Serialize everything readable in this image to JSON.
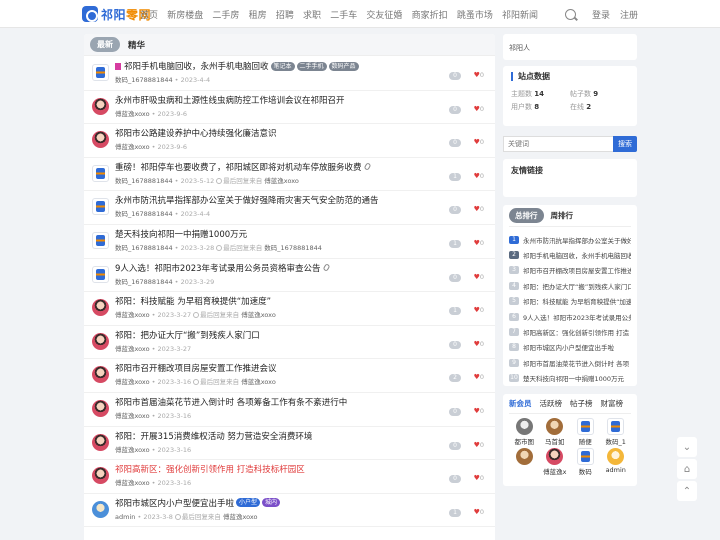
{
  "brand": {
    "part1": "祁阳",
    "part2": "零网"
  },
  "nav": [
    "首页",
    "新房楼盘",
    "二手房",
    "租房",
    "招聘",
    "求职",
    "二手车",
    "交友征婚",
    "商家折扣",
    "跳蚤市场",
    "祁阳新闻"
  ],
  "auth": {
    "login": "登录",
    "register": "注册"
  },
  "tabs": {
    "latest": "最新",
    "best": "精华"
  },
  "threads": [
    {
      "title": "祁阳手机电脑回收，永州手机电脑回收",
      "flag": true,
      "tags": [
        "笔记本",
        "二手手机",
        "数码产品"
      ],
      "author": "数码_1678881844",
      "date": "2023-4-4",
      "last_reply": "",
      "last_user": "",
      "replies": "0",
      "likes": "0",
      "avatar": "icon"
    },
    {
      "title": "永州市肝吸虫病和土源性线虫病防控工作培训会议在祁阳召开",
      "author": "傅蓝逸xoxo",
      "date": "2023-9-6",
      "last_reply": "",
      "last_user": "",
      "replies": "0",
      "likes": "0",
      "avatar": "pink"
    },
    {
      "title": "祁阳市公路建设养护中心持续强化廉洁意识",
      "author": "傅蓝逸xoxo",
      "date": "2023-9-6",
      "last_reply": "",
      "last_user": "",
      "replies": "0",
      "likes": "0",
      "avatar": "pink"
    },
    {
      "title": "重磅！祁阳停车也要收费了，祁阳城区即将对机动车停放服务收费",
      "attach": true,
      "author": "数码_1678881844",
      "date": "2023-5-12",
      "last_reply": "最后回复来自",
      "last_user": "傅蓝逸xoxo",
      "replies": "1",
      "likes": "0",
      "avatar": "icon"
    },
    {
      "title": "永州市防汛抗旱指挥部办公室关于做好强降雨灾害天气安全防范的通告",
      "author": "数码_1678881844",
      "date": "2023-4-4",
      "last_reply": "",
      "last_user": "",
      "replies": "0",
      "likes": "0",
      "avatar": "icon"
    },
    {
      "title": "楚天科技向祁阳一中捐赠1000万元",
      "author": "数码_1678881844",
      "date": "2023-3-28",
      "last_reply": "最后回复来自",
      "last_user": "数码_1678881844",
      "replies": "1",
      "likes": "0",
      "avatar": "icon"
    },
    {
      "title": "9人入选！祁阳市2023年考试录用公务员资格审查公告",
      "attach": true,
      "author": "数码_1678881844",
      "date": "2023-3-29",
      "last_reply": "",
      "last_user": "",
      "replies": "0",
      "likes": "0",
      "avatar": "icon"
    },
    {
      "title": "祁阳：科技赋能 为早稻育秧提供“加速度”",
      "author": "傅蓝逸xoxo",
      "date": "2023-3-27",
      "last_reply": "最后回复来自",
      "last_user": "傅蓝逸xoxo",
      "replies": "1",
      "likes": "0",
      "avatar": "pink"
    },
    {
      "title": "祁阳：把办证大厅“搬”到残疾人家门口",
      "author": "傅蓝逸xoxo",
      "date": "2023-3-27",
      "last_reply": "",
      "last_user": "",
      "replies": "0",
      "likes": "0",
      "avatar": "pink"
    },
    {
      "title": "祁阳市召开棚改项目房屋安置工作推进会议",
      "author": "傅蓝逸xoxo",
      "date": "2023-3-16",
      "last_reply": "最后回复来自",
      "last_user": "傅蓝逸xoxo",
      "replies": "2",
      "likes": "0",
      "avatar": "pink"
    },
    {
      "title": "祁阳市首届油菜花节进入倒计时 各项筹备工作有条不紊进行中",
      "author": "傅蓝逸xoxo",
      "date": "2023-3-16",
      "last_reply": "",
      "last_user": "",
      "replies": "0",
      "likes": "0",
      "avatar": "pink"
    },
    {
      "title": "祁阳：开展315消费维权活动 努力营造安全消费环境",
      "author": "傅蓝逸xoxo",
      "date": "2023-3-16",
      "last_reply": "",
      "last_user": "",
      "replies": "0",
      "likes": "0",
      "avatar": "pink"
    },
    {
      "title": "祁阳高新区：强化创新引领作用 打造科技标杆园区",
      "red": true,
      "author": "傅蓝逸xoxo",
      "date": "2023-3-16",
      "last_reply": "",
      "last_user": "",
      "replies": "0",
      "likes": "0",
      "avatar": "pink"
    },
    {
      "title": "祁阳市城区内小户型便宜出手啦",
      "tags2": [
        "小户型",
        "城内"
      ],
      "author": "admin",
      "date": "2023-3-8",
      "last_reply": "最后回复来自",
      "last_user": "傅蓝逸xoxo",
      "replies": "1",
      "likes": "0",
      "avatar": "blue"
    }
  ],
  "sidebar": {
    "location": "祁阳人",
    "stats_title": "站点数据",
    "stats": [
      {
        "label": "主题数",
        "value": "14"
      },
      {
        "label": "帖子数",
        "value": "9"
      },
      {
        "label": "用户数",
        "value": "8"
      },
      {
        "label": "在线",
        "value": "2"
      }
    ],
    "search_placeholder": "关键词",
    "search_button": "搜索",
    "links_title": "友情链接",
    "rank_tabs": {
      "a": "总排行",
      "b": "周排行"
    },
    "rank": [
      "永州市防汛抗旱指挥部办公室关于做好",
      "祁阳手机电脑回收，永州手机电脑回收",
      "祁阳市召开棚改项目房屋安置工作推进",
      "祁阳：把办证大厅“搬”到残疾人家门口",
      "祁阳：科技赋能 为早稻育秧提供“加速",
      "9人入选！祁阳市2023年考试录用公务",
      "祁阳高新区：强化创新引领作用 打造",
      "祁阳市城区内小户型便宜出手啦",
      "祁阳市首届油菜花节进入倒计时 各项",
      "楚天科技向祁阳一中捐赠1000万元"
    ],
    "member_tabs": [
      "新会员",
      "活跃榜",
      "帖子榜",
      "财富榜"
    ],
    "members": [
      {
        "name": "都市图",
        "av": "g1"
      },
      {
        "name": "马首如",
        "av": "g2"
      },
      {
        "name": "随便",
        "av": "icon"
      },
      {
        "name": "数码_1",
        "av": "icon"
      },
      {
        "name": "",
        "av": "g2"
      },
      {
        "name": "傅蓝逸x",
        "av": "pink"
      },
      {
        "name": "数码",
        "av": "icon"
      },
      {
        "name": "admin",
        "av": "g5"
      }
    ]
  },
  "icons": {
    "search": "search-icon",
    "chevron_down": "chevron-down-icon",
    "home": "home-icon",
    "chevron_up": "chevron-up-icon",
    "heart": "heart-icon",
    "clock": "clock-icon"
  },
  "colors": {
    "accent": "#2f6bd6",
    "brand_orange": "#f08a00",
    "hot_red": "#e03c3c"
  }
}
